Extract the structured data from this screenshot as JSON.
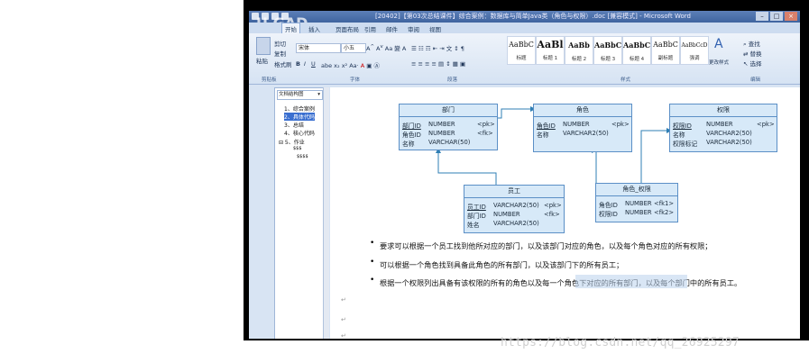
{
  "window": {
    "title": "[20402]【第03次总结课件】综合案例：数据库与简单Java类（角色与权限）.doc [兼容模式] - Microsoft Word",
    "overlay_logo": "U GAD"
  },
  "ribbon": {
    "tabs": [
      "开始",
      "插入",
      "页面布局",
      "引用",
      "邮件",
      "审阅",
      "视图"
    ],
    "active_tab": "开始",
    "clipboard": {
      "paste": "粘贴",
      "cut": "剪切",
      "copy": "复制",
      "format_painter": "格式刷",
      "group": "剪贴板"
    },
    "font": {
      "family": "宋体",
      "size": "小五",
      "group": "字体"
    },
    "paragraph": {
      "group": "段落"
    },
    "styles": {
      "group": "样式",
      "items": [
        {
          "preview": "AaBbC",
          "name": "标题"
        },
        {
          "preview": "AaBl",
          "name": "标题 1"
        },
        {
          "preview": "AaBb",
          "name": "标题 2"
        },
        {
          "preview": "AaBbC",
          "name": "标题 3"
        },
        {
          "preview": "AaBbC",
          "name": "标题 4"
        },
        {
          "preview": "AaBbC",
          "name": "副标题"
        },
        {
          "preview": "AaBbCcD",
          "name": "强调"
        }
      ],
      "change_styles": "更改样式"
    },
    "editing": {
      "find": "查找",
      "replace": "替换",
      "select": "选择",
      "group": "编辑"
    }
  },
  "nav": {
    "dropdown": "文档结构图",
    "items": [
      {
        "label": "1、综合案例",
        "selected": false
      },
      {
        "label": "2、具体代码",
        "selected": true
      },
      {
        "label": "3、总结",
        "selected": false
      },
      {
        "label": "4、核心代码",
        "selected": false
      },
      {
        "label": "⊟ 5、作业",
        "selected": false
      },
      {
        "label": "$$$",
        "selected": false
      },
      {
        "label": "$$$$",
        "selected": false
      }
    ]
  },
  "diagram": {
    "tables": [
      {
        "id": "dept",
        "title": "部门",
        "rows": [
          [
            "部门ID",
            "NUMBER",
            "<pk>"
          ],
          [
            "角色ID",
            "NUMBER",
            "<fk>"
          ],
          [
            "名称",
            "VARCHAR(50)",
            ""
          ]
        ]
      },
      {
        "id": "role",
        "title": "角色",
        "rows": [
          [
            "角色ID",
            "NUMBER",
            "<pk>"
          ],
          [
            "名称",
            "VARCHAR2(50)",
            ""
          ]
        ]
      },
      {
        "id": "priv",
        "title": "权限",
        "rows": [
          [
            "权限ID",
            "NUMBER",
            "<pk>"
          ],
          [
            "名称",
            "VARCHAR2(50)",
            ""
          ],
          [
            "权限标记",
            "VARCHAR2(50)",
            ""
          ]
        ]
      },
      {
        "id": "emp",
        "title": "员工",
        "rows": [
          [
            "员工ID",
            "VARCHAR2(50)",
            "<pk>"
          ],
          [
            "部门ID",
            "NUMBER",
            "<fk>"
          ],
          [
            "姓名",
            "VARCHAR2(50)",
            ""
          ]
        ]
      },
      {
        "id": "rp",
        "title": "角色_权限",
        "rows": [
          [
            "角色ID",
            "NUMBER",
            "<fk1>"
          ],
          [
            "权限ID",
            "NUMBER",
            "<fk2>"
          ]
        ]
      }
    ]
  },
  "bullets": [
    "要求可以根据一个员工找到他所对应的部门，以及该部门对应的角色，以及每个角色对应的所有权限；",
    "可以根据一个角色找到具备此角色的所有部门，以及该部门下的所有员工；",
    "根据一个权限列出具备有该权限的所有的角色以及每一个角色下对应的所有部门，以及每个部门中的所有员工。"
  ],
  "watermark": "https://blog.csdn.net/qq_26925297"
}
